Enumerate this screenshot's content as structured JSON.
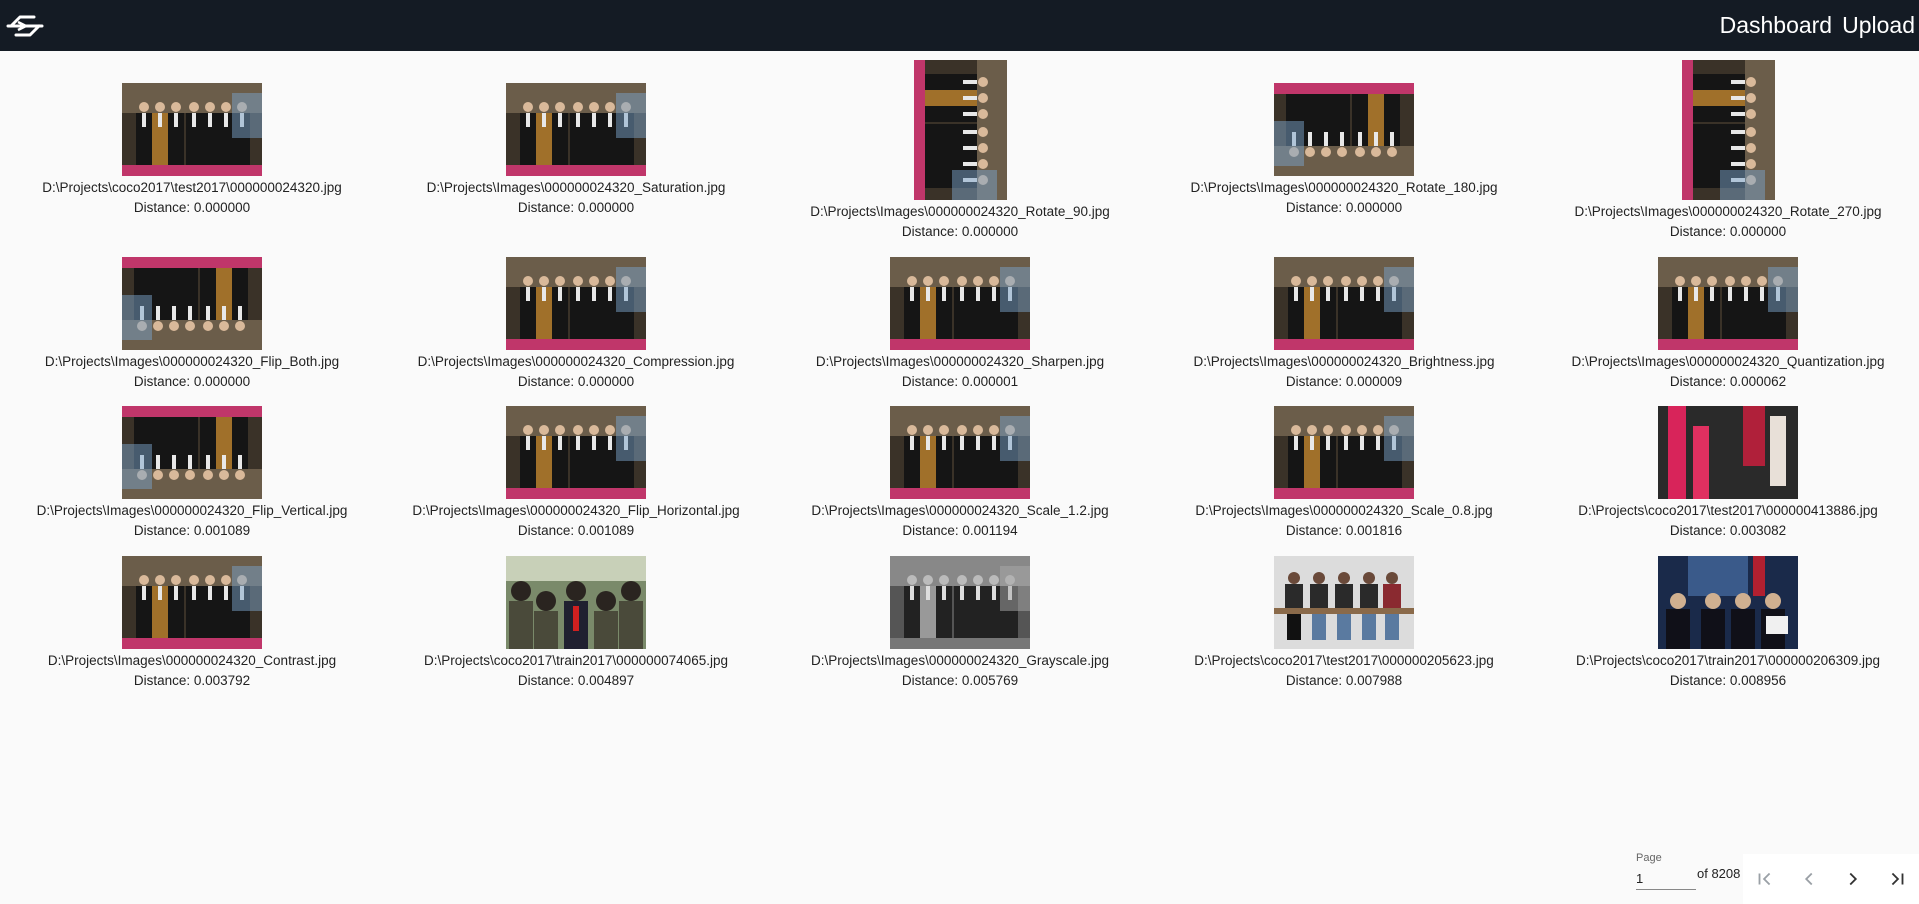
{
  "header": {
    "nav": [
      "Dashboard",
      "Upload"
    ]
  },
  "results": [
    {
      "path": "D:\\Projects\\coco2017\\test2017\\000000024320.jpg",
      "distance": "Distance: 0.000000",
      "image": "group-of-men-in-suits"
    },
    {
      "path": "D:\\Projects\\Images\\000000024320_Saturation.jpg",
      "distance": "Distance: 0.000000",
      "image": "group-of-men-in-suits"
    },
    {
      "path": "D:\\Projects\\Images\\000000024320_Rotate_90.jpg",
      "distance": "Distance: 0.000000",
      "image": "group-of-men-in-suits-rotated"
    },
    {
      "path": "D:\\Projects\\Images\\000000024320_Rotate_180.jpg",
      "distance": "Distance: 0.000000",
      "image": "group-of-men-in-suits-upside-down"
    },
    {
      "path": "D:\\Projects\\Images\\000000024320_Rotate_270.jpg",
      "distance": "Distance: 0.000000",
      "image": "group-of-men-in-suits-rotated"
    },
    {
      "path": "D:\\Projects\\Images\\000000024320_Flip_Both.jpg",
      "distance": "Distance: 0.000000",
      "image": "group-of-men-in-suits-upside-down"
    },
    {
      "path": "D:\\Projects\\Images\\000000024320_Compression.jpg",
      "distance": "Distance: 0.000000",
      "image": "group-of-men-in-suits"
    },
    {
      "path": "D:\\Projects\\Images\\000000024320_Sharpen.jpg",
      "distance": "Distance: 0.000001",
      "image": "group-of-men-in-suits"
    },
    {
      "path": "D:\\Projects\\Images\\000000024320_Brightness.jpg",
      "distance": "Distance: 0.000009",
      "image": "group-of-men-in-suits"
    },
    {
      "path": "D:\\Projects\\Images\\000000024320_Quantization.jpg",
      "distance": "Distance: 0.000062",
      "image": "group-of-men-in-suits"
    },
    {
      "path": "D:\\Projects\\Images\\000000024320_Flip_Vertical.jpg",
      "distance": "Distance: 0.001089",
      "image": "group-of-men-in-suits-upside-down"
    },
    {
      "path": "D:\\Projects\\Images\\000000024320_Flip_Horizontal.jpg",
      "distance": "Distance: 0.001089",
      "image": "group-of-men-in-suits"
    },
    {
      "path": "D:\\Projects\\Images\\000000024320_Scale_1.2.jpg",
      "distance": "Distance: 0.001194",
      "image": "group-of-men-in-suits"
    },
    {
      "path": "D:\\Projects\\Images\\000000024320_Scale_0.8.jpg",
      "distance": "Distance: 0.001816",
      "image": "group-of-men-in-suits"
    },
    {
      "path": "D:\\Projects\\coco2017\\test2017\\000000413886.jpg",
      "distance": "Distance: 0.003082",
      "image": "dancers-in-red"
    },
    {
      "path": "D:\\Projects\\Images\\000000024320_Contrast.jpg",
      "distance": "Distance: 0.003792",
      "image": "group-of-men-in-suits"
    },
    {
      "path": "D:\\Projects\\coco2017\\train2017\\000000074065.jpg",
      "distance": "Distance: 0.004897",
      "image": "crowd-on-train"
    },
    {
      "path": "D:\\Projects\\Images\\000000024320_Grayscale.jpg",
      "distance": "Distance: 0.005769",
      "image": "group-of-men-in-suits-grayscale"
    },
    {
      "path": "D:\\Projects\\coco2017\\test2017\\000000205623.jpg",
      "distance": "Distance: 0.007988",
      "image": "band-sitting-on-bench"
    },
    {
      "path": "D:\\Projects\\coco2017\\train2017\\000000206309.jpg",
      "distance": "Distance: 0.008956",
      "image": "press-conference"
    }
  ],
  "pagination": {
    "label": "Page",
    "current": "1",
    "total_text": "of 8208"
  },
  "colors": {
    "topbar": "#141b24",
    "background": "#fafafa"
  },
  "icons": [
    "logo-icon",
    "first-page-icon",
    "previous-page-icon",
    "next-page-icon",
    "last-page-icon"
  ]
}
